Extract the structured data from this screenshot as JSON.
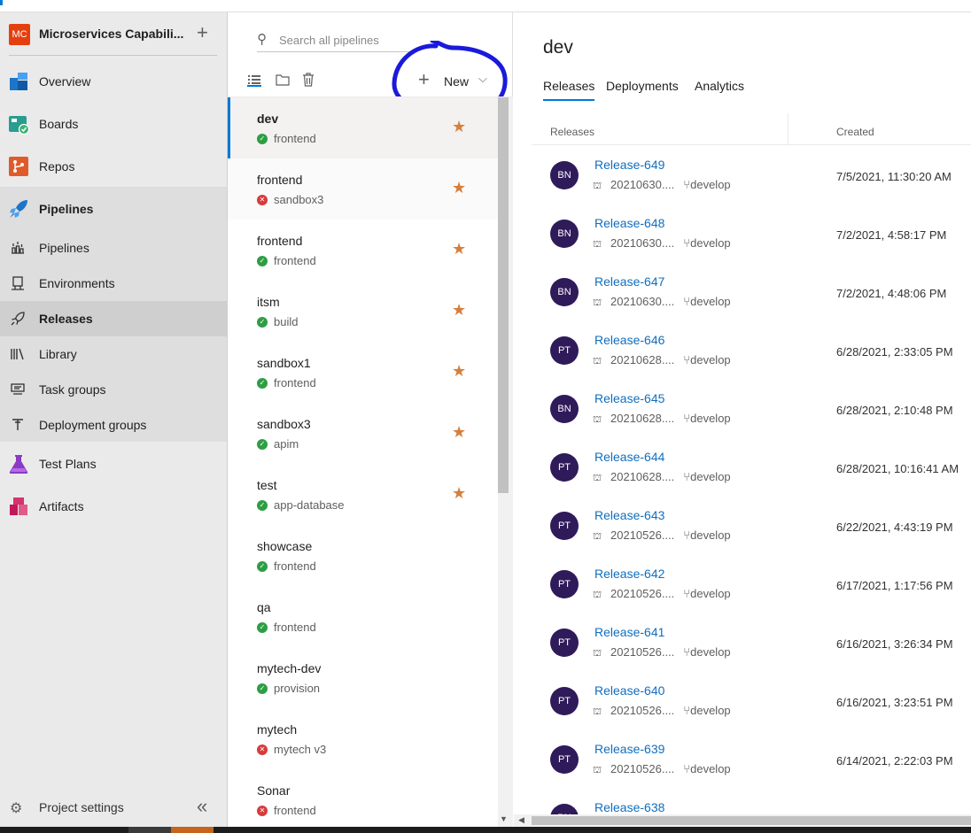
{
  "project": {
    "initials": "MC",
    "name": "Microservices Capabili..."
  },
  "nav": {
    "overview": "Overview",
    "boards": "Boards",
    "repos": "Repos",
    "pipelines_section": "Pipelines",
    "pipelines": "Pipelines",
    "environments": "Environments",
    "releases": "Releases",
    "library": "Library",
    "task_groups": "Task groups",
    "deployment_groups": "Deployment groups",
    "test_plans": "Test Plans",
    "artifacts": "Artifacts",
    "project_settings": "Project settings"
  },
  "search": {
    "placeholder": "Search all pipelines"
  },
  "new_button": "New",
  "pipelines": [
    {
      "name": "dev",
      "stage": "frontend",
      "status": "succeeded",
      "selected": true
    },
    {
      "name": "frontend",
      "stage": "sandbox3",
      "status": "failed"
    },
    {
      "name": "frontend",
      "stage": "frontend",
      "status": "succeeded"
    },
    {
      "name": "itsm",
      "stage": "build",
      "status": "succeeded"
    },
    {
      "name": "sandbox1",
      "stage": "frontend",
      "status": "succeeded"
    },
    {
      "name": "sandbox3",
      "stage": "apim",
      "status": "succeeded"
    },
    {
      "name": "test",
      "stage": "app-database",
      "status": "succeeded"
    },
    {
      "name": "showcase",
      "stage": "frontend",
      "status": "succeeded"
    },
    {
      "name": "qa",
      "stage": "frontend",
      "status": "succeeded"
    },
    {
      "name": "mytech-dev",
      "stage": "provision",
      "status": "succeeded"
    },
    {
      "name": "mytech",
      "stage": "mytech v3",
      "status": "failed"
    },
    {
      "name": "Sonar",
      "stage": "frontend",
      "status": "failed"
    }
  ],
  "detail": {
    "title": "dev",
    "tabs": [
      "Releases",
      "Deployments",
      "Analytics"
    ],
    "columns": {
      "releases": "Releases",
      "created": "Created"
    },
    "releases": [
      {
        "initials": "BN",
        "name": "Release-649",
        "build": "20210630....",
        "branch": "develop",
        "created": "7/5/2021, 11:30:20 AM"
      },
      {
        "initials": "BN",
        "name": "Release-648",
        "build": "20210630....",
        "branch": "develop",
        "created": "7/2/2021, 4:58:17 PM"
      },
      {
        "initials": "BN",
        "name": "Release-647",
        "build": "20210630....",
        "branch": "develop",
        "created": "7/2/2021, 4:48:06 PM"
      },
      {
        "initials": "PT",
        "name": "Release-646",
        "build": "20210628....",
        "branch": "develop",
        "created": "6/28/2021, 2:33:05 PM"
      },
      {
        "initials": "BN",
        "name": "Release-645",
        "build": "20210628....",
        "branch": "develop",
        "created": "6/28/2021, 2:10:48 PM"
      },
      {
        "initials": "PT",
        "name": "Release-644",
        "build": "20210628....",
        "branch": "develop",
        "created": "6/28/2021, 10:16:41 AM"
      },
      {
        "initials": "PT",
        "name": "Release-643",
        "build": "20210526....",
        "branch": "develop",
        "created": "6/22/2021, 4:43:19 PM"
      },
      {
        "initials": "PT",
        "name": "Release-642",
        "build": "20210526....",
        "branch": "develop",
        "created": "6/17/2021, 1:17:56 PM"
      },
      {
        "initials": "PT",
        "name": "Release-641",
        "build": "20210526....",
        "branch": "develop",
        "created": "6/16/2021, 3:26:34 PM"
      },
      {
        "initials": "PT",
        "name": "Release-640",
        "build": "20210526....",
        "branch": "develop",
        "created": "6/16/2021, 3:23:51 PM"
      },
      {
        "initials": "PT",
        "name": "Release-639",
        "build": "20210526....",
        "branch": "develop",
        "created": "6/14/2021, 2:22:03 PM"
      },
      {
        "initials": "BN",
        "name": "Release-638",
        "build": "",
        "branch": "",
        "created": ""
      }
    ]
  },
  "colors": {
    "accent": "#0078d4",
    "link": "#106ebe",
    "star": "#d67f3c",
    "success": "#2e9e44",
    "failure": "#d83b3b",
    "avatar": "#2f1a5a",
    "annotation": "#1a1adb"
  },
  "icons": {
    "search": "search-icon",
    "star": "star-icon",
    "plus": "plus-icon",
    "chevron": "chevron-down-icon",
    "list": "list-view-icon",
    "folder": "folder-icon",
    "trash": "trash-icon",
    "gear": "gear-icon",
    "collapse": "collapse-icon"
  }
}
